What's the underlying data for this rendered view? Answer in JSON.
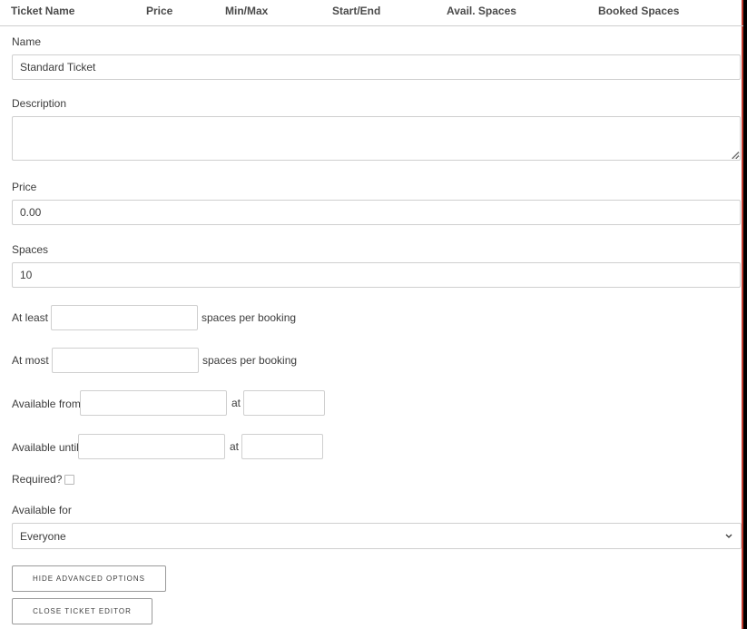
{
  "table_header": {
    "ticket_name": "Ticket Name",
    "price": "Price",
    "min_max": "Min/Max",
    "start_end": "Start/End",
    "avail_spaces": "Avail. Spaces",
    "booked_spaces": "Booked Spaces"
  },
  "form": {
    "name_label": "Name",
    "name_value": "Standard Ticket",
    "description_label": "Description",
    "description_value": "",
    "price_label": "Price",
    "price_value": "0.00",
    "spaces_label": "Spaces",
    "spaces_value": "10",
    "at_least_label": "At least",
    "at_least_value": "",
    "at_least_suffix": "spaces per booking",
    "at_most_label": "At most",
    "at_most_value": "",
    "at_most_suffix": "spaces per booking",
    "available_from_label": "Available from",
    "available_from_date": "",
    "available_from_at": "at",
    "available_from_time": "",
    "available_until_label": "Available until",
    "available_until_date": "",
    "available_until_at": "at",
    "available_until_time": "",
    "required_label": "Required?",
    "required_checked": false,
    "available_for_label": "Available for",
    "available_for_value": "Everyone"
  },
  "buttons": {
    "hide_advanced": "Hide Advanced Options",
    "close_editor": "Close Ticket Editor"
  },
  "colors": {
    "accent_border": "#c0392b",
    "field_border": "#cfcfcf"
  }
}
